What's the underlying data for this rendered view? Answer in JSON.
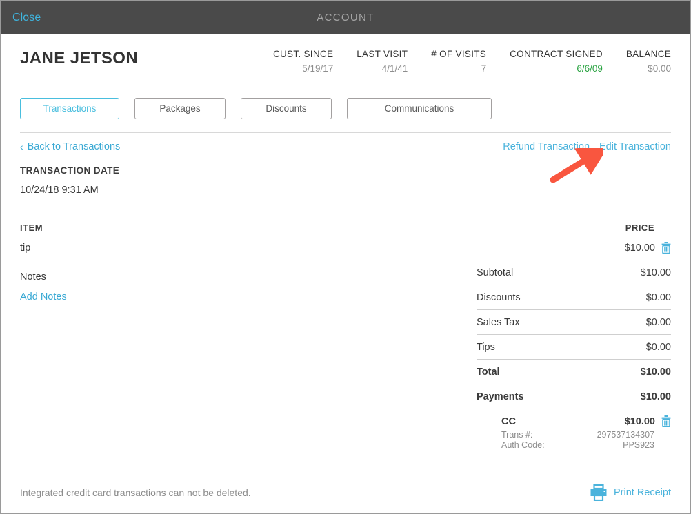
{
  "topbar": {
    "close_label": "Close",
    "title": "ACCOUNT"
  },
  "customer": {
    "name": "JANE JETSON",
    "stats": [
      {
        "label": "CUST. SINCE",
        "value": "5/19/17",
        "color": "#8d8d8d"
      },
      {
        "label": "LAST VISIT",
        "value": "4/1/41",
        "color": "#8d8d8d"
      },
      {
        "label": "# OF VISITS",
        "value": "7",
        "color": "#8d8d8d"
      },
      {
        "label": "CONTRACT SIGNED",
        "value": "6/6/09",
        "color": "#2aa342"
      },
      {
        "label": "BALANCE",
        "value": "$0.00",
        "color": "#8d8d8d"
      }
    ]
  },
  "tabs": [
    {
      "label": "Transactions",
      "active": true
    },
    {
      "label": "Packages",
      "active": false
    },
    {
      "label": "Discounts",
      "active": false
    },
    {
      "label": "Communications",
      "active": false
    }
  ],
  "actions": {
    "back_label": "Back to Transactions",
    "back_chevron": "‹",
    "refund_label": "Refund Transaction",
    "edit_label": "Edit Transaction"
  },
  "transaction": {
    "date_label": "TRANSACTION DATE",
    "date_value": "10/24/18 9:31 AM",
    "item_header": "ITEM",
    "price_header": "PRICE",
    "items": [
      {
        "name": "tip",
        "price": "$10.00",
        "delete_icon": "trash-icon"
      }
    ],
    "notes_label": "Notes",
    "add_notes_label": "Add Notes"
  },
  "summary": {
    "rows": [
      {
        "label": "Subtotal",
        "value": "$10.00",
        "bold": false
      },
      {
        "label": "Discounts",
        "value": "$0.00",
        "bold": false
      },
      {
        "label": "Sales Tax",
        "value": "$0.00",
        "bold": false
      },
      {
        "label": "Tips",
        "value": "$0.00",
        "bold": false
      },
      {
        "label": "Total",
        "value": "$10.00",
        "bold": true
      },
      {
        "label": "Payments",
        "value": "$10.00",
        "bold": true
      }
    ]
  },
  "payment": {
    "method": "CC",
    "amount": "$10.00",
    "trans_label": "Trans #:",
    "trans_value": "297537134307",
    "auth_label": "Auth Code:",
    "auth_value": "PPS923",
    "delete_icon": "trash-icon"
  },
  "footer": {
    "note": "Integrated credit card transactions can not be deleted.",
    "print_label": "Print Receipt",
    "print_icon": "printer-icon"
  },
  "theme": {
    "accent": "#4ab3dc",
    "topbar_bg": "#4a4a4a",
    "text": "#3b3b3b",
    "muted": "#8d8d8d",
    "green": "#2aa342",
    "annotation_arrow": "#f9563f"
  }
}
